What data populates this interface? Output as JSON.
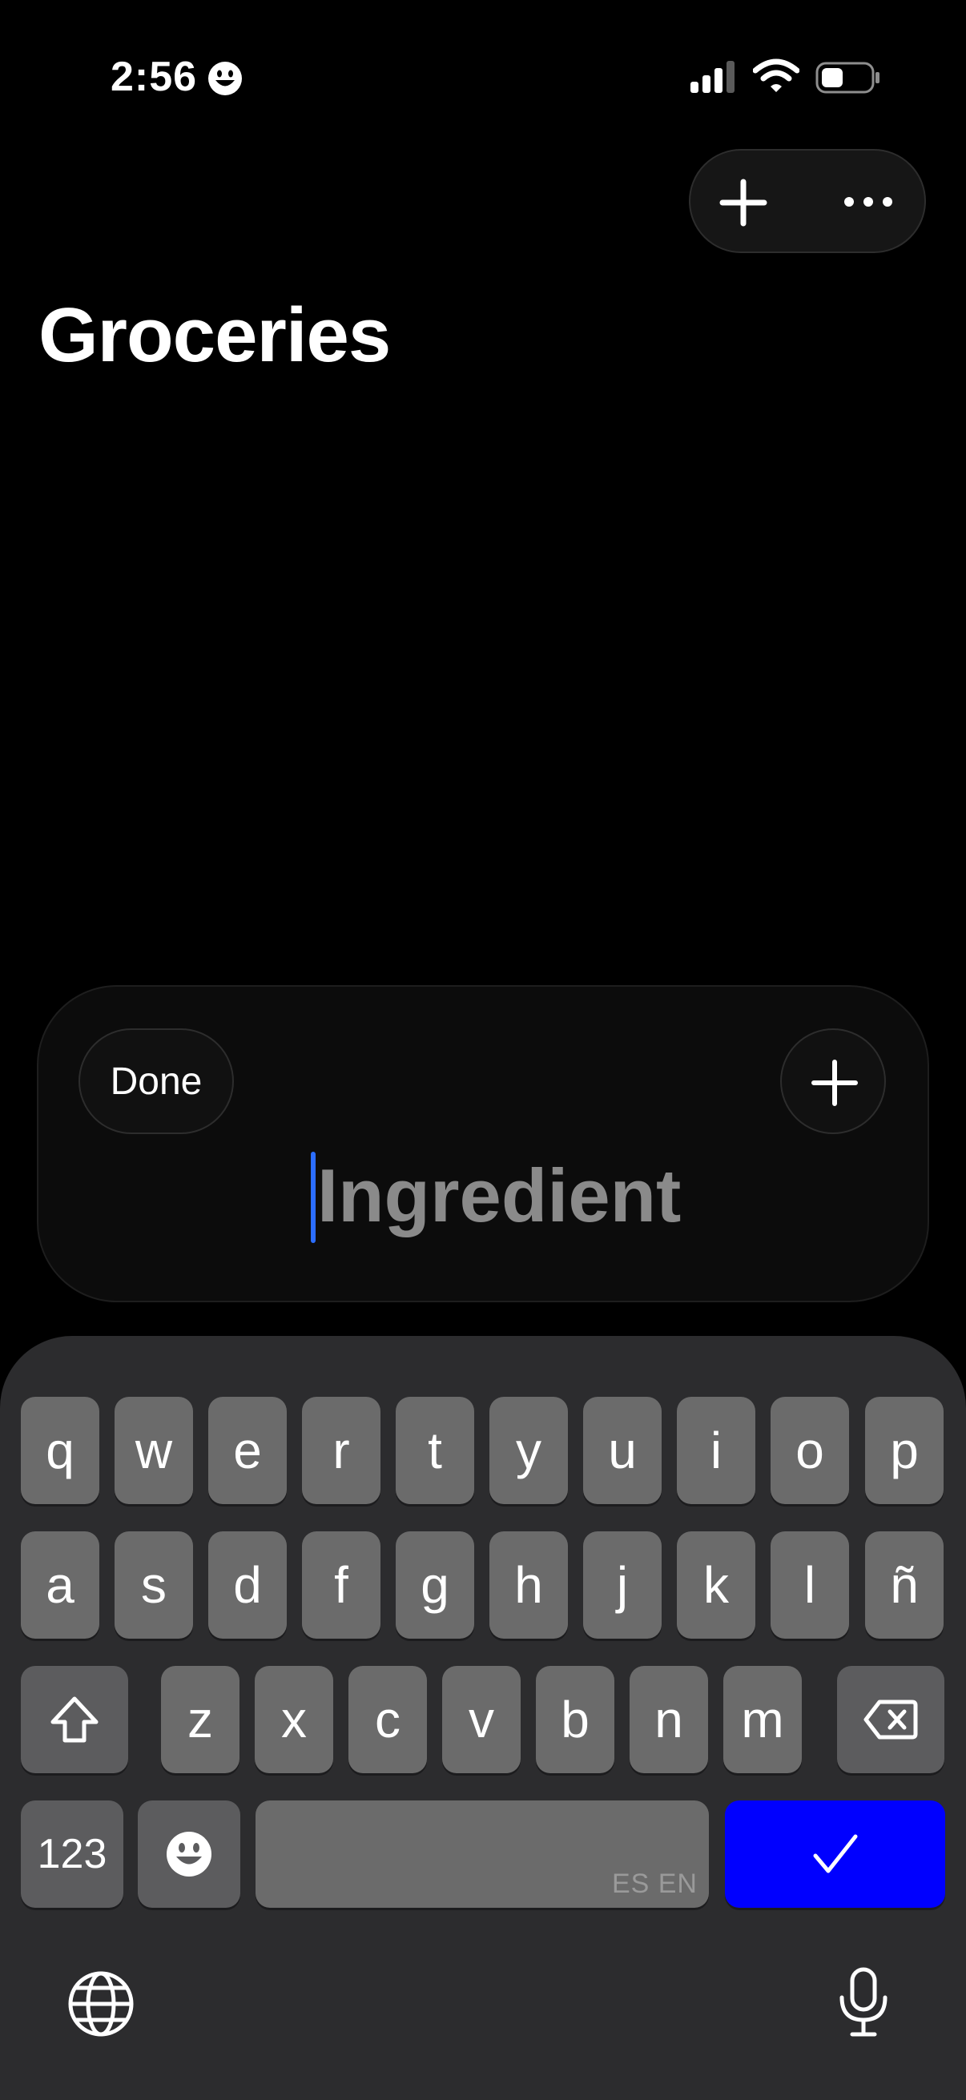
{
  "status_bar": {
    "time": "2:56",
    "icons": [
      "smiley-icon",
      "cellular-signal-icon",
      "wifi-icon",
      "battery-icon"
    ]
  },
  "top_actions": {
    "add_icon": "plus-icon",
    "more_icon": "ellipsis-icon"
  },
  "page": {
    "title": "Groceries"
  },
  "input_card": {
    "done_label": "Done",
    "add_icon": "plus-icon",
    "placeholder": "Ingredient",
    "value": ""
  },
  "keyboard": {
    "row1": [
      "q",
      "w",
      "e",
      "r",
      "t",
      "y",
      "u",
      "i",
      "o",
      "p"
    ],
    "row2": [
      "a",
      "s",
      "d",
      "f",
      "g",
      "h",
      "j",
      "k",
      "l",
      "ñ"
    ],
    "row3": [
      "z",
      "x",
      "c",
      "v",
      "b",
      "n",
      "m"
    ],
    "numbers_label": "123",
    "space_hint": "ES EN",
    "icons": [
      "shift-icon",
      "delete-icon",
      "emoji-icon",
      "checkmark-icon",
      "globe-icon",
      "microphone-icon"
    ],
    "return_color": "#0000ff"
  }
}
